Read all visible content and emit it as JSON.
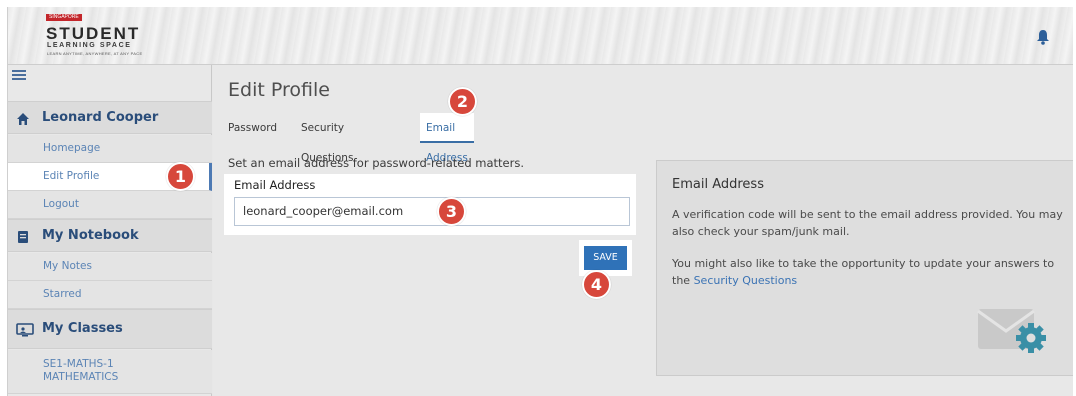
{
  "header": {
    "logo": {
      "tag": "SINGAPORE",
      "line1": "STUDENT",
      "line2": "LEARNING SPACE",
      "tagline": "LEARN ANYTIME, ANYWHERE, AT ANY PACE"
    },
    "notification_icon": "bell-icon"
  },
  "sidebar": {
    "menu_icon": "hamburger-icon",
    "sections": [
      {
        "title": "Leonard Cooper",
        "icon": "home-icon",
        "items": [
          {
            "label": "Homepage"
          },
          {
            "label": "Edit Profile",
            "active": true
          },
          {
            "label": "Logout"
          }
        ]
      },
      {
        "title": "My Notebook",
        "icon": "notebook-icon",
        "items": [
          {
            "label": "My Notes"
          },
          {
            "label": "Starred"
          }
        ]
      },
      {
        "title": "My Classes",
        "icon": "classroom-icon",
        "items": [
          {
            "label_line1": "SE1-MATHS-1",
            "label_line2": "MATHEMATICS"
          }
        ]
      }
    ]
  },
  "main": {
    "page_title": "Edit Profile",
    "tabs": [
      {
        "label": "Password"
      },
      {
        "label": "Security Questions"
      },
      {
        "label": "Email Address",
        "active": true
      }
    ],
    "intro_text": "Set an email address for password-related matters.",
    "email_label": "Email Address",
    "email_value": "leonard_cooper@email.com",
    "save_label": "SAVE"
  },
  "info_panel": {
    "heading": "Email Address",
    "para1": "A verification code will be sent to the email address provided. You may also check your spam/junk mail.",
    "para2_prefix": "You might also like to take the opportunity to update your answers to the ",
    "para2_link": "Security Questions"
  },
  "markers": [
    "1",
    "2",
    "3",
    "4"
  ],
  "colors": {
    "accent": "#2f72b8",
    "marker": "#d7473b",
    "sidebar_link": "#5b84b5",
    "section_title": "#2a4d7a"
  }
}
